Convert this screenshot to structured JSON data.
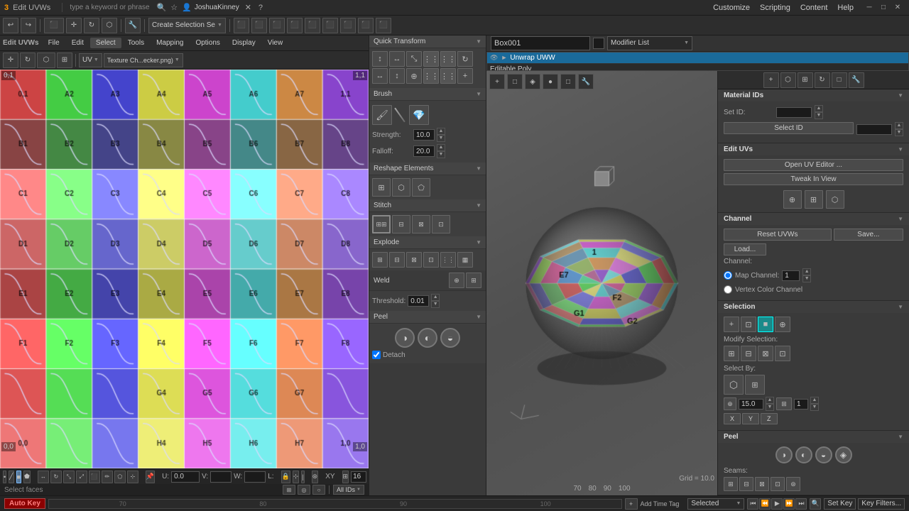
{
  "app": {
    "title": "Edit UVWs",
    "logo": "3",
    "logo_color": "#ff6600"
  },
  "top_menu": {
    "items": [
      "Customize",
      "Scripting",
      "Content",
      "Help"
    ],
    "create_selection": "Create Selection Se",
    "search_placeholder": "type a keyword or phrase",
    "user": "JoshuaKinney"
  },
  "uv_editor": {
    "title": "Edit UVWs",
    "menu": [
      "File",
      "Edit",
      "Select",
      "Tools",
      "Mapping",
      "Options",
      "Display",
      "View"
    ],
    "texture": "Texture Ch...ecker.png)",
    "format": "UV"
  },
  "toolbar_bottom": {
    "uvw_label": "U:",
    "v_label": "V:",
    "w_label": "W:",
    "l_label": "L:",
    "value_uv": "0.0",
    "axis": "XY",
    "grid_val": "16",
    "select_faces": "Select faces",
    "all_ids": "All IDs"
  },
  "rollouts": {
    "quick_transform": {
      "label": "Quick Transform"
    },
    "brush": {
      "label": "Brush",
      "strength_label": "Strength:",
      "strength_val": "10.0",
      "falloff_label": "Falloff:",
      "falloff_val": "20.0"
    },
    "reshape_elements": {
      "label": "Reshape Elements"
    },
    "stitch": {
      "label": "Stitch"
    },
    "explode": {
      "label": "Explode"
    },
    "weld": {
      "label": "Weld",
      "threshold_label": "Threshold:",
      "threshold_val": "0.01"
    },
    "peel": {
      "label": "Peel",
      "detach_label": "Detach"
    }
  },
  "object_panel": {
    "object_name": "Box001",
    "modifier_list_label": "Modifier List",
    "modifiers": [
      "Unwrap UWW",
      "Editable Poly"
    ],
    "unwrap_active": true
  },
  "material_ids": {
    "header": "Material IDs",
    "set_id_label": "Set ID:",
    "select_id_label": "Select ID"
  },
  "edit_uvs": {
    "header": "Edit UVs",
    "open_editor": "Open UV Editor ...",
    "tweak_view": "Tweak In View"
  },
  "channel": {
    "header": "Channel",
    "reset_uvws": "Reset UVWs",
    "save": "Save...",
    "load": "Load...",
    "channel_label": "Channel:",
    "map_channel": "Map Channel:",
    "map_channel_val": "1",
    "vertex_color": "Vertex Color Channel"
  },
  "selection_panel": {
    "header": "Selection",
    "modify_selection": "Modify Selection:",
    "select_by": "Select By:"
  },
  "peel_right": {
    "header": "Peel",
    "seams_label": "Seams:"
  },
  "timeline": {
    "autokey": "Auto Key",
    "selected": "Selected",
    "set_key": "Set Key",
    "key_filters": "Key Filters...",
    "grid_label": "Grid = 10.0",
    "add_time_tag": "Add Time Tag",
    "values": [
      "70",
      "80",
      "90",
      "100"
    ]
  }
}
